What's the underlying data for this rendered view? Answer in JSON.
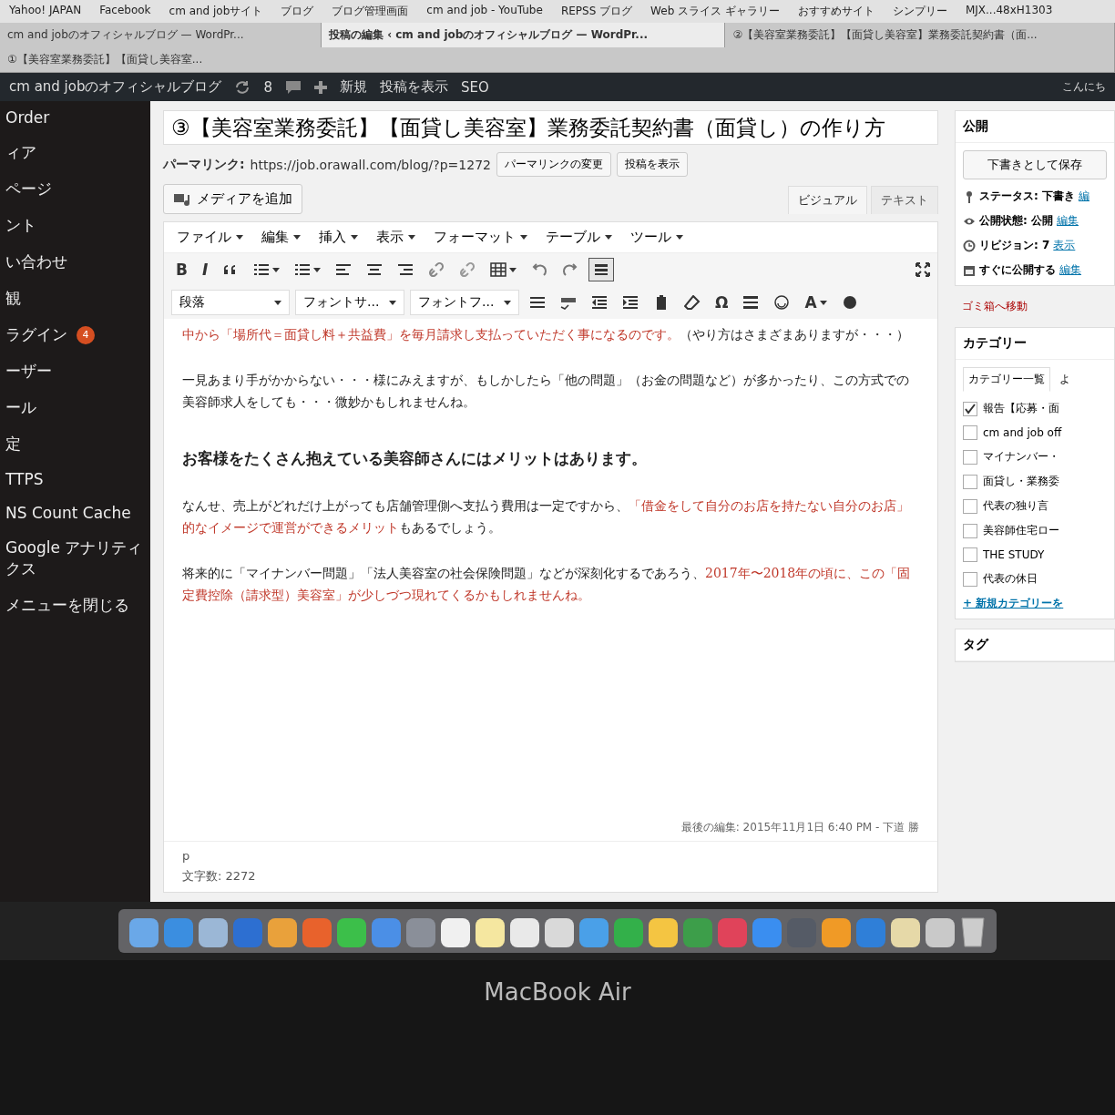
{
  "bookmarks": [
    "Yahoo! JAPAN",
    "Facebook",
    "cm and jobサイト",
    "ブログ",
    "ブログ管理画面",
    "cm and job - YouTube",
    "REPSS ブログ",
    "Web スライス ギャラリー",
    "おすすめサイト",
    "シンプリー",
    "MJX...48xH1303"
  ],
  "browser_tabs": [
    {
      "title": "cm and jobのオフィシャルブログ — WordPr...",
      "selected": false
    },
    {
      "title": "投稿の編集 ‹ cm and jobのオフィシャルブログ — WordPr...",
      "selected": true
    },
    {
      "title": "②【美容室業務委託】【面貸し美容室】業務委託契約書（面...",
      "selected": false
    },
    {
      "title": "①【美容室業務委託】【面貸し美容室...",
      "selected": false
    }
  ],
  "admin_bar": {
    "site_name": "cm and jobのオフィシャルブログ",
    "updates": "8",
    "new": "新規",
    "view_post": "投稿を表示",
    "seo": "SEO",
    "greeting": "こんにち"
  },
  "sidebar": {
    "items": [
      {
        "label": "Order"
      },
      {
        "label": "ィア"
      },
      {
        "label": "ページ"
      },
      {
        "label": "ント"
      },
      {
        "label": "い合わせ"
      },
      {
        "label": "観"
      },
      {
        "label": "ラグイン",
        "badge": "4"
      },
      {
        "label": "ーザー"
      },
      {
        "label": "ール"
      },
      {
        "label": "定"
      },
      {
        "label": "TTPS"
      },
      {
        "label": "NS Count Cache"
      },
      {
        "label": "Google アナリティクス"
      },
      {
        "label": "メニューを閉じる"
      }
    ]
  },
  "editor": {
    "title": "③【美容室業務委託】【面貸し美容室】業務委託契約書（面貸し）の作り方",
    "permalink_label": "パーマリンク:",
    "permalink": "https://job.orawall.com/blog/?p=1272",
    "change_permalink": "パーマリンクの変更",
    "view_post": "投稿を表示",
    "add_media": "メディアを追加",
    "mode_tabs": [
      {
        "label": "ビジュアル",
        "selected": true
      },
      {
        "label": "テキスト",
        "selected": false
      }
    ],
    "menubar": [
      "ファイル",
      "編集",
      "挿入",
      "表示",
      "フォーマット",
      "テーブル",
      "ツール"
    ],
    "toolbar_row1": [
      {
        "kind": "glyph",
        "label": "B"
      },
      {
        "kind": "glyph",
        "label": "I"
      },
      {
        "kind": "quote"
      },
      {
        "kind": "bullets",
        "caret": true
      },
      {
        "kind": "numbers",
        "caret": true
      },
      {
        "kind": "alignleft"
      },
      {
        "kind": "aligncenter"
      },
      {
        "kind": "alignright"
      },
      {
        "kind": "link"
      },
      {
        "kind": "unlink"
      },
      {
        "kind": "table",
        "caret": true
      },
      {
        "kind": "undo"
      },
      {
        "kind": "redo"
      },
      {
        "kind": "toggle"
      }
    ],
    "selects": [
      "段落",
      "フォントサ...",
      "フォントフ..."
    ],
    "toolbar_row2": [
      {
        "kind": "justify"
      },
      {
        "kind": "spell"
      },
      {
        "kind": "outdent"
      },
      {
        "kind": "indent"
      },
      {
        "kind": "paste"
      },
      {
        "kind": "eraser"
      },
      {
        "kind": "glyph",
        "label": "Ω"
      },
      {
        "kind": "hr"
      },
      {
        "kind": "smiley"
      },
      {
        "kind": "textcolor",
        "label": "A",
        "caret": true
      },
      {
        "kind": "help"
      }
    ],
    "content": [
      {
        "kind": "paragraph",
        "segments": [
          {
            "text": "中から「場所代＝面貸し料＋共益費」を毎月請求し支払っていただく事になるのです。",
            "red": true
          },
          {
            "text": "（やり方はさまざまありますが・・・）",
            "red": false
          }
        ]
      },
      {
        "kind": "paragraph",
        "segments": [
          {
            "text": "一見あまり手がかからない・・・様にみえますが、もしかしたら「他の問題」（お金の問題など）が多かったり、この方式での美容師求人をしても・・・微妙かもしれませんね。",
            "red": false
          }
        ]
      },
      {
        "kind": "heading",
        "segments": [
          {
            "text": "お客様をたくさん抱えている美容師さんにはメリットはあります。",
            "red": false
          }
        ]
      },
      {
        "kind": "paragraph",
        "segments": [
          {
            "text": "なんせ、売上がどれだけ上がっても店舗管理側へ支払う費用は一定ですから、",
            "red": false
          },
          {
            "text": "「借金をして自分のお店を持たない自分のお店」的なイメージで運営ができるメリット",
            "red": true
          },
          {
            "text": "もあるでしょう。",
            "red": false
          }
        ]
      },
      {
        "kind": "paragraph",
        "segments": [
          {
            "text": "将来的に「マイナンバー問題」「法人美容室の社会保険問題」などが深刻化するであろう、",
            "red": false
          },
          {
            "text": "2017年〜2018年の頃に、この「固定費控除（請求型）美容室」が少しづつ現れてくるかもしれませんね。",
            "red": true
          }
        ]
      }
    ],
    "last_edit": "最後の編集: 2015年11月1日 6:40 PM - 下道 勝",
    "path": "p",
    "word_count": "文字数: 2272"
  },
  "publish": {
    "title": "公開",
    "save_draft": "下書きとして保存",
    "rows": [
      {
        "kind": "status",
        "label": "ステータス: 下書き",
        "link": "編"
      },
      {
        "kind": "visibility",
        "label": "公開状態: 公開",
        "link": "編集"
      },
      {
        "kind": "revisions",
        "label": "リビジョン: 7",
        "link": "表示"
      },
      {
        "kind": "schedule",
        "label": "すぐに公開する",
        "link": "編集"
      }
    ],
    "trash": "ゴミ箱へ移動"
  },
  "categories": {
    "title": "カテゴリー",
    "tabs": [
      {
        "label": "カテゴリー一覧",
        "selected": true
      },
      {
        "label": "よ",
        "selected": false
      }
    ],
    "items": [
      {
        "label": "報告【応募・面",
        "checked": true
      },
      {
        "label": "cm and job off",
        "checked": false
      },
      {
        "label": "マイナンバー・",
        "checked": false
      },
      {
        "label": "面貸し・業務委",
        "checked": false
      },
      {
        "label": "代表の独り言",
        "checked": false
      },
      {
        "label": "美容師住宅ロー",
        "checked": false
      },
      {
        "label": "THE STUDY",
        "checked": false
      },
      {
        "label": "代表の休日",
        "checked": false
      }
    ],
    "add_new": "+ 新規カテゴリーを"
  },
  "tags": {
    "title": "タグ"
  },
  "laptop": {
    "model": "MacBook Air"
  }
}
